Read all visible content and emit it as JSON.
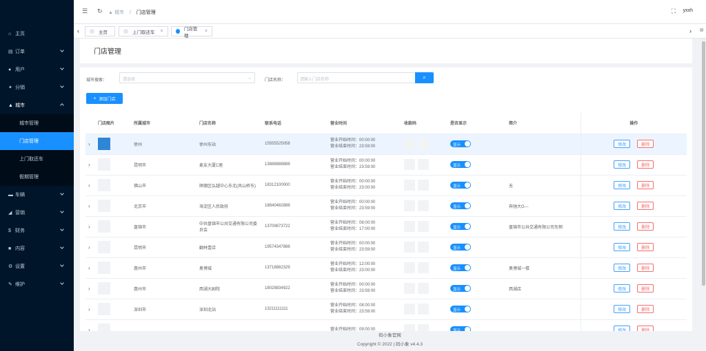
{
  "topbar": {
    "breadcrumb_parent": "城市",
    "breadcrumb_sep": "/",
    "breadcrumb_current": "门店管理",
    "username": "yxxh"
  },
  "sidebar": {
    "items": [
      {
        "icon": "home-icon",
        "label": "主页",
        "glyph": "⌂"
      },
      {
        "icon": "cart-icon",
        "label": "订单",
        "glyph": "▤"
      },
      {
        "icon": "user-icon",
        "label": "用户",
        "glyph": "●"
      },
      {
        "icon": "share-icon",
        "label": "分销",
        "glyph": "✦"
      },
      {
        "icon": "city-icon",
        "label": "城市",
        "glyph": "▲"
      }
    ],
    "city_sub": [
      "城市管理",
      "门店管理",
      "上门取还车",
      "假期管理"
    ],
    "items_after": [
      {
        "icon": "car-icon",
        "label": "车辆",
        "glyph": "▬"
      },
      {
        "icon": "marketing-icon",
        "label": "营销",
        "glyph": "◢"
      },
      {
        "icon": "finance-icon",
        "label": "财务",
        "glyph": "$"
      },
      {
        "icon": "content-icon",
        "label": "内容",
        "glyph": "■"
      },
      {
        "icon": "settings-icon",
        "label": "设置",
        "glyph": "⚙"
      },
      {
        "icon": "maintenance-icon",
        "label": "维护",
        "glyph": "✎"
      }
    ]
  },
  "tags": [
    {
      "label": "主页",
      "closable": false,
      "active": false
    },
    {
      "label": "上门取还车",
      "closable": true,
      "active": false
    },
    {
      "label": "门店管理",
      "closable": true,
      "active": true
    }
  ],
  "page": {
    "title": "门店管理",
    "city_label": "城市搜索：",
    "city_placeholder": "请选择",
    "store_label": "门店名称：",
    "store_placeholder": "请输入门店名称",
    "add_button": "添加门店"
  },
  "table": {
    "headers": [
      "门店图片",
      "所属城市",
      "门店名称",
      "联系电话",
      "营业时间",
      "收款码",
      "是否显示",
      "简介",
      "操作"
    ],
    "open_prefix": "营业开始时间：",
    "close_prefix": "营业结束时间：",
    "switch_label": "显示",
    "edit_label": "修改",
    "delete_label": "删除",
    "rows": [
      {
        "city": "徐州",
        "name": "徐州东站",
        "phone": "15555525058",
        "open": "00:00:00",
        "close": "23:59:00",
        "intro": ""
      },
      {
        "city": "昆明市",
        "name": "麦友大厦C座",
        "phone": "13888888888",
        "open": "00:00:00",
        "close": "23:59:00",
        "intro": ""
      },
      {
        "city": "佛山市",
        "name": "顺德区弘越中心东北(凤山桥东)",
        "phone": "18312100000",
        "open": "00:00:00",
        "close": "23:00:00",
        "intro": "无"
      },
      {
        "city": "北京市",
        "name": "海淀区人民政府",
        "phone": "18840482888",
        "open": "00:00:00",
        "close": "23:59:00",
        "intro": "奔驰大G---"
      },
      {
        "city": "盘锦市",
        "name": "中共盘锦市公共交通有限公司委员会",
        "phone": "13709873722",
        "open": "08:00:00",
        "close": "17:00:00",
        "intro": "盘锦市公共交通有限公司东侧"
      },
      {
        "city": "昆明市",
        "name": "翻林壹店",
        "phone": "19574347888",
        "open": "00:00:00",
        "close": "23:59:00",
        "intro": ""
      },
      {
        "city": "惠州市",
        "name": "奥博城",
        "phone": "13718882329",
        "open": "12:00:00",
        "close": "23:00:00",
        "intro": "奥博城一楼"
      },
      {
        "city": "惠州市",
        "name": "西湖大剧院",
        "phone": "18028834922",
        "open": "00:00:00",
        "close": "23:59:00",
        "intro": "西湖店"
      },
      {
        "city": "深圳市",
        "name": "深圳北站",
        "phone": "13211111111",
        "open": "08:00:00",
        "close": "23:59:00",
        "intro": ""
      },
      {
        "city": "",
        "name": "",
        "phone": "",
        "open": "09:00:00",
        "close": "",
        "intro": ""
      }
    ]
  },
  "footer": {
    "brand": "码小象官网",
    "copyright": "Copyright © 2022 | 码小象 v4.4.3"
  }
}
